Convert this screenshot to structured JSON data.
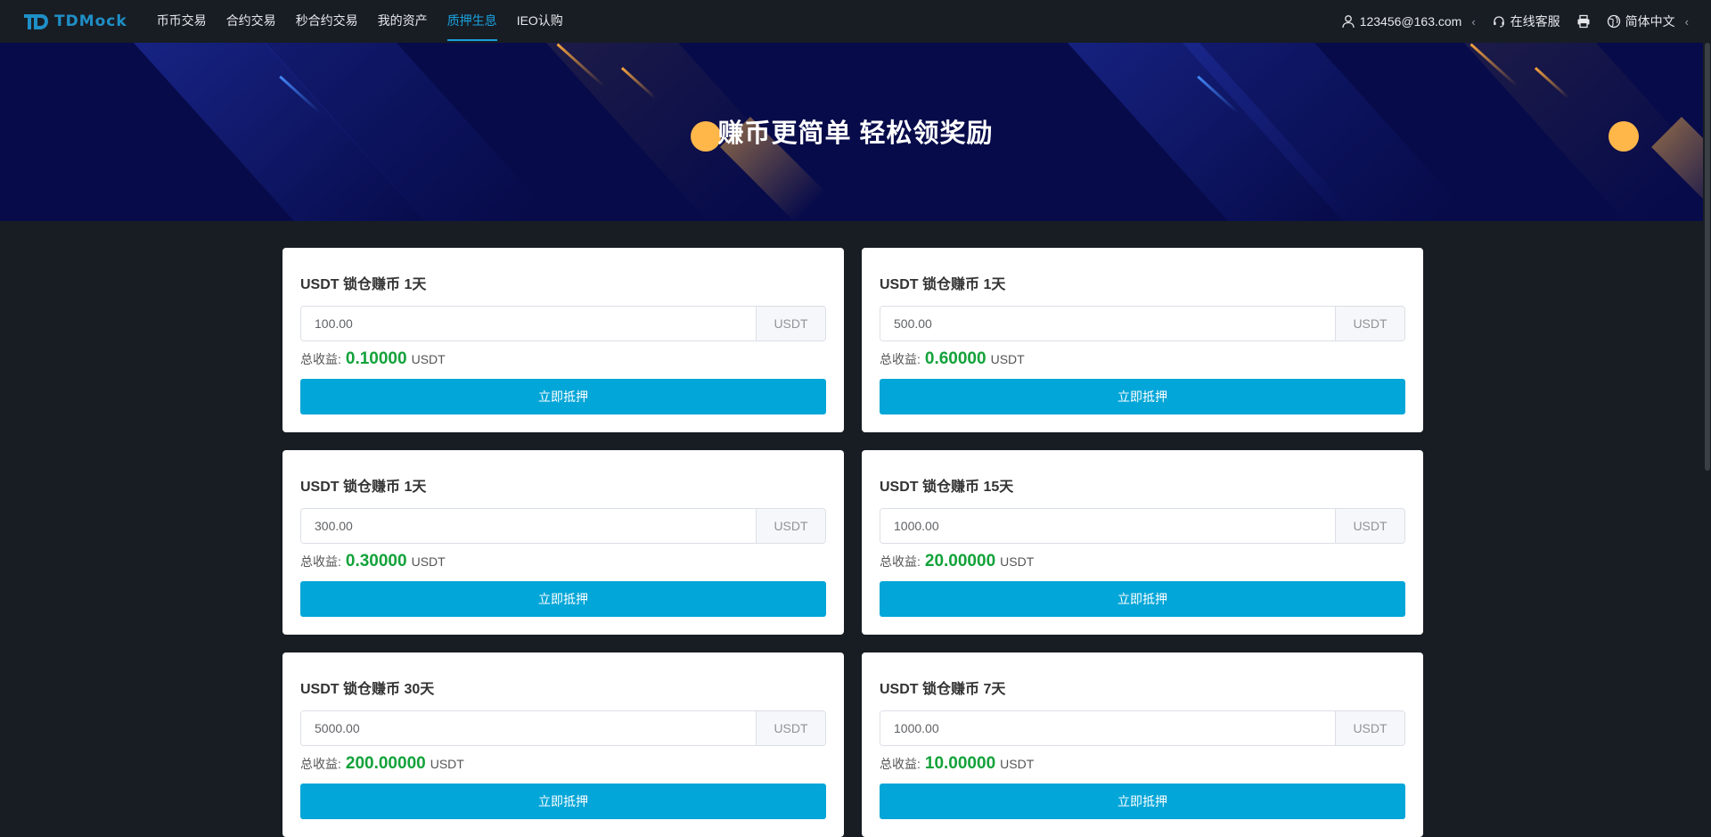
{
  "nav": {
    "logo_text": "TDMock",
    "items": [
      {
        "label": "币币交易"
      },
      {
        "label": "合约交易"
      },
      {
        "label": "秒合约交易"
      },
      {
        "label": "我的资产"
      },
      {
        "label": "质押生息",
        "active": true
      },
      {
        "label": "IEO认购"
      }
    ],
    "account": "123456@163.com",
    "service": "在线客服",
    "language": "简体中文",
    "icons": {
      "account": "user-icon",
      "service": "headset-icon",
      "print": "printer-icon",
      "language": "globe-icon"
    },
    "accent": "#1aa0dc"
  },
  "banner": {
    "title": "赚币更简单 轻松领奖励"
  },
  "profit_label": "总收益:",
  "unit_label": "USDT",
  "button_label": "立即抵押",
  "cards": [
    {
      "title": "USDT 锁仓赚币 1天",
      "amount": "100.00",
      "profit": "0.10000",
      "unit": "USDT"
    },
    {
      "title": "USDT 锁仓赚币 1天",
      "amount": "500.00",
      "profit": "0.60000",
      "unit": "USDT"
    },
    {
      "title": "USDT 锁仓赚币 1天",
      "amount": "300.00",
      "profit": "0.30000",
      "unit": "USDT"
    },
    {
      "title": "USDT 锁仓赚币 15天",
      "amount": "1000.00",
      "profit": "20.00000",
      "unit": "USDT"
    },
    {
      "title": "USDT 锁仓赚币 30天",
      "amount": "5000.00",
      "profit": "200.00000",
      "unit": "USDT"
    },
    {
      "title": "USDT 锁仓赚币 7天",
      "amount": "1000.00",
      "profit": "10.00000",
      "unit": "USDT"
    }
  ],
  "colors": {
    "button": "#03a6d8",
    "profit": "#13a23a",
    "banner_bg": "#070b4a",
    "page_bg": "#181d24"
  }
}
